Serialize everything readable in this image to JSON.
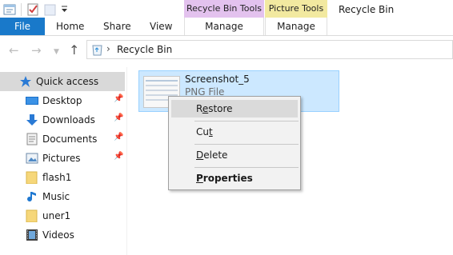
{
  "window": {
    "title": "Recycle Bin"
  },
  "ribbon": {
    "contextual": [
      {
        "group": "Recycle Bin Tools",
        "tab": "Manage"
      },
      {
        "group": "Picture Tools",
        "tab": "Manage"
      }
    ],
    "tabs": {
      "file": "File",
      "home": "Home",
      "share": "Share",
      "view": "View"
    }
  },
  "address": {
    "path": "Recycle Bin"
  },
  "nav": {
    "items": [
      {
        "label": "Quick access",
        "icon": "star-icon"
      },
      {
        "label": "Desktop",
        "icon": "desktop-icon",
        "pinned": true
      },
      {
        "label": "Downloads",
        "icon": "download-icon",
        "pinned": true
      },
      {
        "label": "Documents",
        "icon": "documents-icon",
        "pinned": true
      },
      {
        "label": "Pictures",
        "icon": "pictures-icon",
        "pinned": true
      },
      {
        "label": "flash1",
        "icon": "folder-icon"
      },
      {
        "label": "Music",
        "icon": "music-icon"
      },
      {
        "label": "uner1",
        "icon": "folder-icon"
      },
      {
        "label": "Videos",
        "icon": "videos-icon"
      }
    ]
  },
  "file": {
    "name": "Screenshot_5",
    "type": "PNG File"
  },
  "context_menu": {
    "restore_pre": "R",
    "restore_key": "e",
    "restore_post": "store",
    "cut_pre": "Cu",
    "cut_key": "t",
    "delete_key": "D",
    "delete_post": "elete",
    "properties_key": "P",
    "properties_post": "roperties"
  },
  "colors": {
    "file_tab": "#1979ca",
    "recycle_tools": "#e3c2ee",
    "picture_tools": "#f2e9a0",
    "selection": "#cce8ff"
  }
}
